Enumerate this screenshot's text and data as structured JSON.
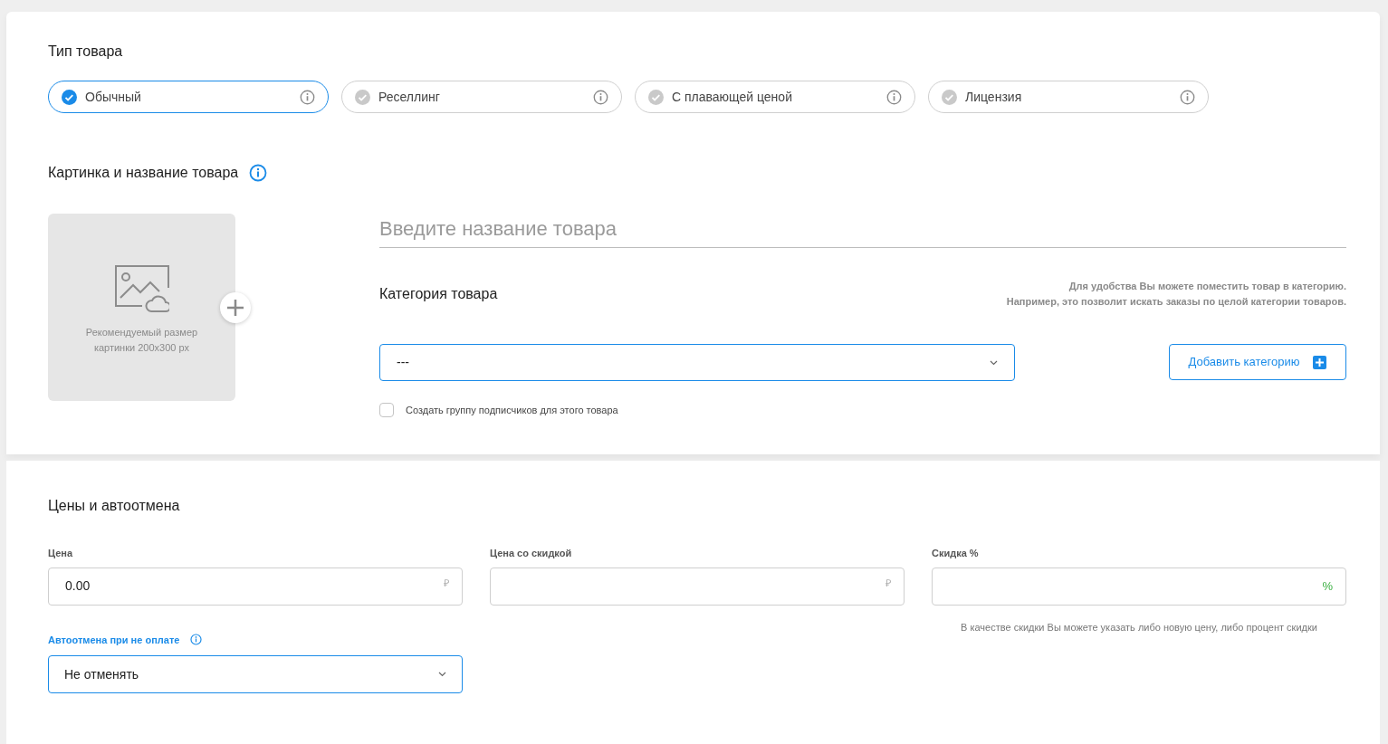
{
  "product_type": {
    "title": "Тип товара",
    "options": [
      {
        "label": "Обычный",
        "selected": true
      },
      {
        "label": "Реселлинг",
        "selected": false
      },
      {
        "label": "С плавающей ценой",
        "selected": false
      },
      {
        "label": "Лицензия",
        "selected": false
      }
    ]
  },
  "image_and_name": {
    "title": "Картинка и название товара",
    "image_hint": "Рекомендуемый размер картинки 200x300 px",
    "name_placeholder": "Введите название товара",
    "category": {
      "title": "Категория товара",
      "hint_lines": [
        "Для удобства Вы можете поместить товар в категорию.",
        "Например, это позволит искать заказы по целой категории товаров."
      ],
      "value": "---",
      "add_button": "Добавить категорию"
    },
    "subscribers_checkbox": {
      "label": "Создать группу подписчиков для этого товара",
      "checked": false
    }
  },
  "prices": {
    "title": "Цены и автоотмена",
    "fields": [
      {
        "label": "Цена",
        "value": "0.00",
        "suffix": "₽",
        "kind": "currency"
      },
      {
        "label": "Цена со скидкой",
        "suffix": "₽",
        "kind": "currency"
      },
      {
        "label": "Скидка %",
        "suffix": "%",
        "kind": "percent"
      }
    ],
    "discount_hint": "В качестве скидки Вы можете указать либо новую цену, либо процент скидки",
    "autocancel": {
      "label": "Автоотмена при не оплате",
      "value": "Не отменять"
    }
  }
}
